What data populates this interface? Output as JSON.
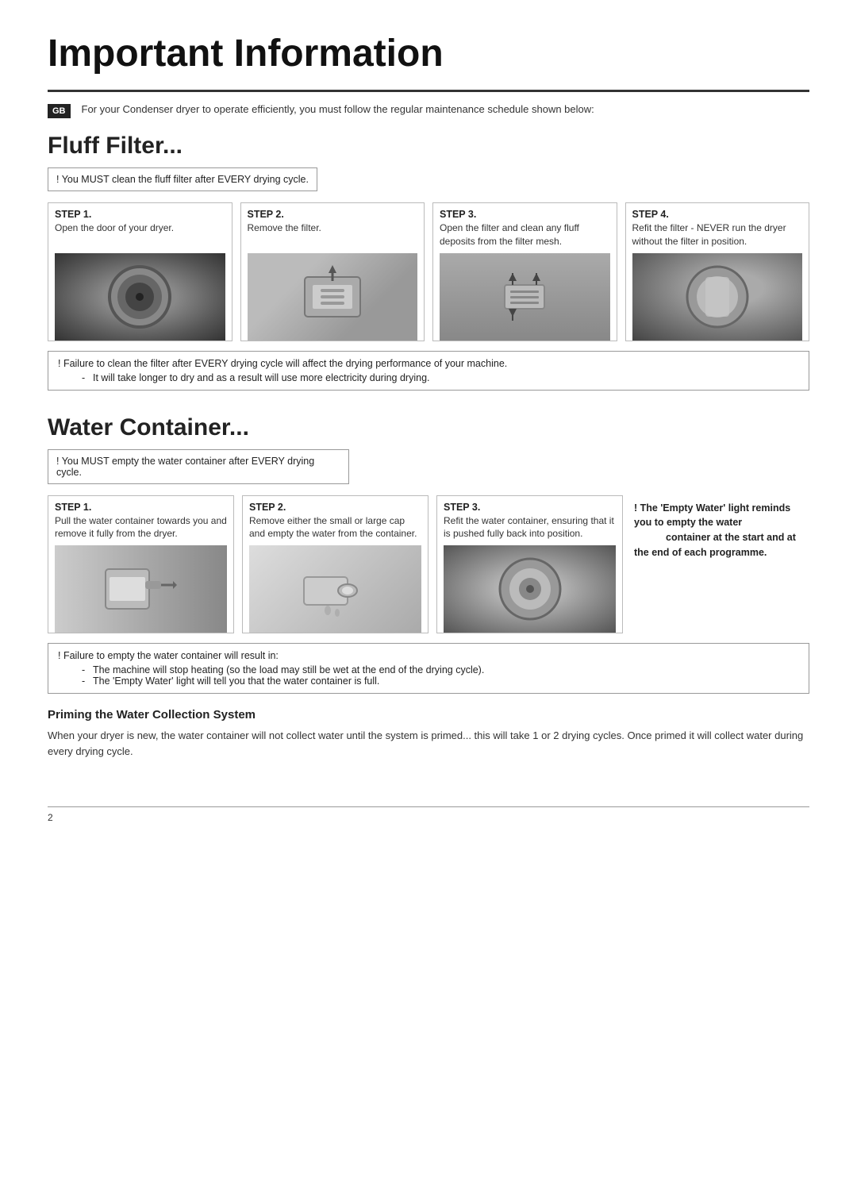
{
  "page": {
    "title": "Important Information",
    "page_number": "2"
  },
  "gb_badge": "GB",
  "intro_text": "For your Condenser dryer to operate efficiently, you must follow the regular maintenance schedule shown below:",
  "fluff_filter": {
    "section_title": "Fluff Filter...",
    "warning": "! You MUST clean the fluff filter after EVERY drying cycle.",
    "steps": [
      {
        "label": "STEP 1.",
        "description": "Open the door of your dryer."
      },
      {
        "label": "STEP 2.",
        "description": "Remove the filter."
      },
      {
        "label": "STEP 3.",
        "description": "Open the filter and clean any fluff deposits from the filter mesh."
      },
      {
        "label": "STEP 4.",
        "description": "Refit the filter - NEVER run the dryer without the filter in position."
      }
    ],
    "failure_text": "! Failure to clean the filter after EVERY drying cycle will affect the drying performance of your machine.",
    "failure_bullets": [
      "It will take longer to dry and as a result will use more electricity during drying."
    ]
  },
  "water_container": {
    "section_title": "Water Container...",
    "warning": "! You MUST empty the water container after EVERY drying cycle.",
    "steps": [
      {
        "label": "STEP 1.",
        "description": "Pull the water container towards you and remove it fully from the dryer."
      },
      {
        "label": "STEP 2.",
        "description": "Remove either the small or large cap and empty the water from the container."
      },
      {
        "label": "STEP 3.",
        "description": "Refit the water container, ensuring that it is pushed fully back into position."
      }
    ],
    "special_note_bold": "! The 'Empty Water' light reminds you to empty the water",
    "special_note_rest": "container at the start and at the end of each programme.",
    "failure_text": "! Failure to empty the water container will result in:",
    "failure_bullets": [
      "The machine will stop heating (so the load may still be wet at the end of the drying cycle).",
      "The 'Empty Water' light will tell you that the water container is full."
    ]
  },
  "priming": {
    "title": "Priming the Water Collection System",
    "text": "When your dryer is new, the water container will not collect water until the system is primed... this will take 1 or 2 drying cycles. Once primed it will collect water during every drying cycle."
  }
}
